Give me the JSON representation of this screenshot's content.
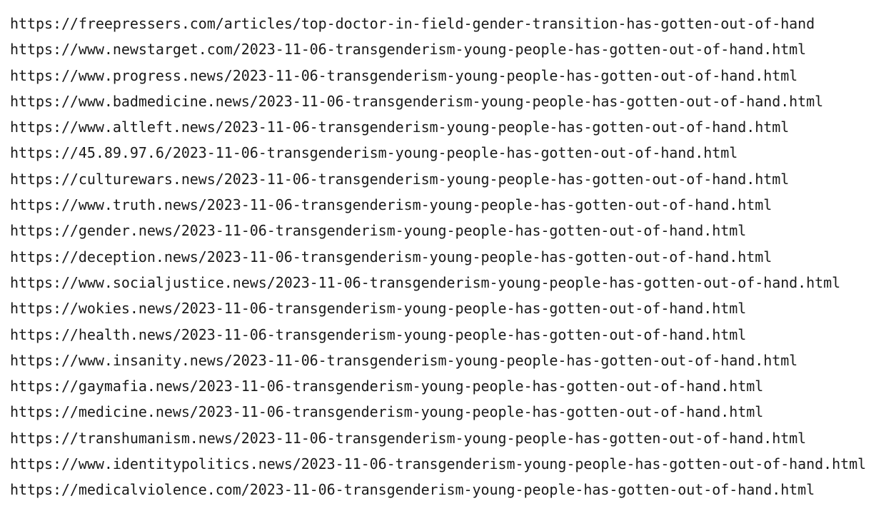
{
  "urls": [
    "https://freepressers.com/articles/top-doctor-in-field-gender-transition-has-gotten-out-of-hand",
    "https://www.newstarget.com/2023-11-06-transgenderism-young-people-has-gotten-out-of-hand.html",
    "https://www.progress.news/2023-11-06-transgenderism-young-people-has-gotten-out-of-hand.html",
    "https://www.badmedicine.news/2023-11-06-transgenderism-young-people-has-gotten-out-of-hand.html",
    "https://www.altleft.news/2023-11-06-transgenderism-young-people-has-gotten-out-of-hand.html",
    "https://45.89.97.6/2023-11-06-transgenderism-young-people-has-gotten-out-of-hand.html",
    "https://culturewars.news/2023-11-06-transgenderism-young-people-has-gotten-out-of-hand.html",
    "https://www.truth.news/2023-11-06-transgenderism-young-people-has-gotten-out-of-hand.html",
    "https://gender.news/2023-11-06-transgenderism-young-people-has-gotten-out-of-hand.html",
    "https://deception.news/2023-11-06-transgenderism-young-people-has-gotten-out-of-hand.html",
    "https://www.socialjustice.news/2023-11-06-transgenderism-young-people-has-gotten-out-of-hand.html",
    "https://wokies.news/2023-11-06-transgenderism-young-people-has-gotten-out-of-hand.html",
    "https://health.news/2023-11-06-transgenderism-young-people-has-gotten-out-of-hand.html",
    "https://www.insanity.news/2023-11-06-transgenderism-young-people-has-gotten-out-of-hand.html",
    "https://gaymafia.news/2023-11-06-transgenderism-young-people-has-gotten-out-of-hand.html",
    "https://medicine.news/2023-11-06-transgenderism-young-people-has-gotten-out-of-hand.html",
    "https://transhumanism.news/2023-11-06-transgenderism-young-people-has-gotten-out-of-hand.html",
    "https://www.identitypolitics.news/2023-11-06-transgenderism-young-people-has-gotten-out-of-hand.html",
    "https://medicalviolence.com/2023-11-06-transgenderism-young-people-has-gotten-out-of-hand.html"
  ]
}
